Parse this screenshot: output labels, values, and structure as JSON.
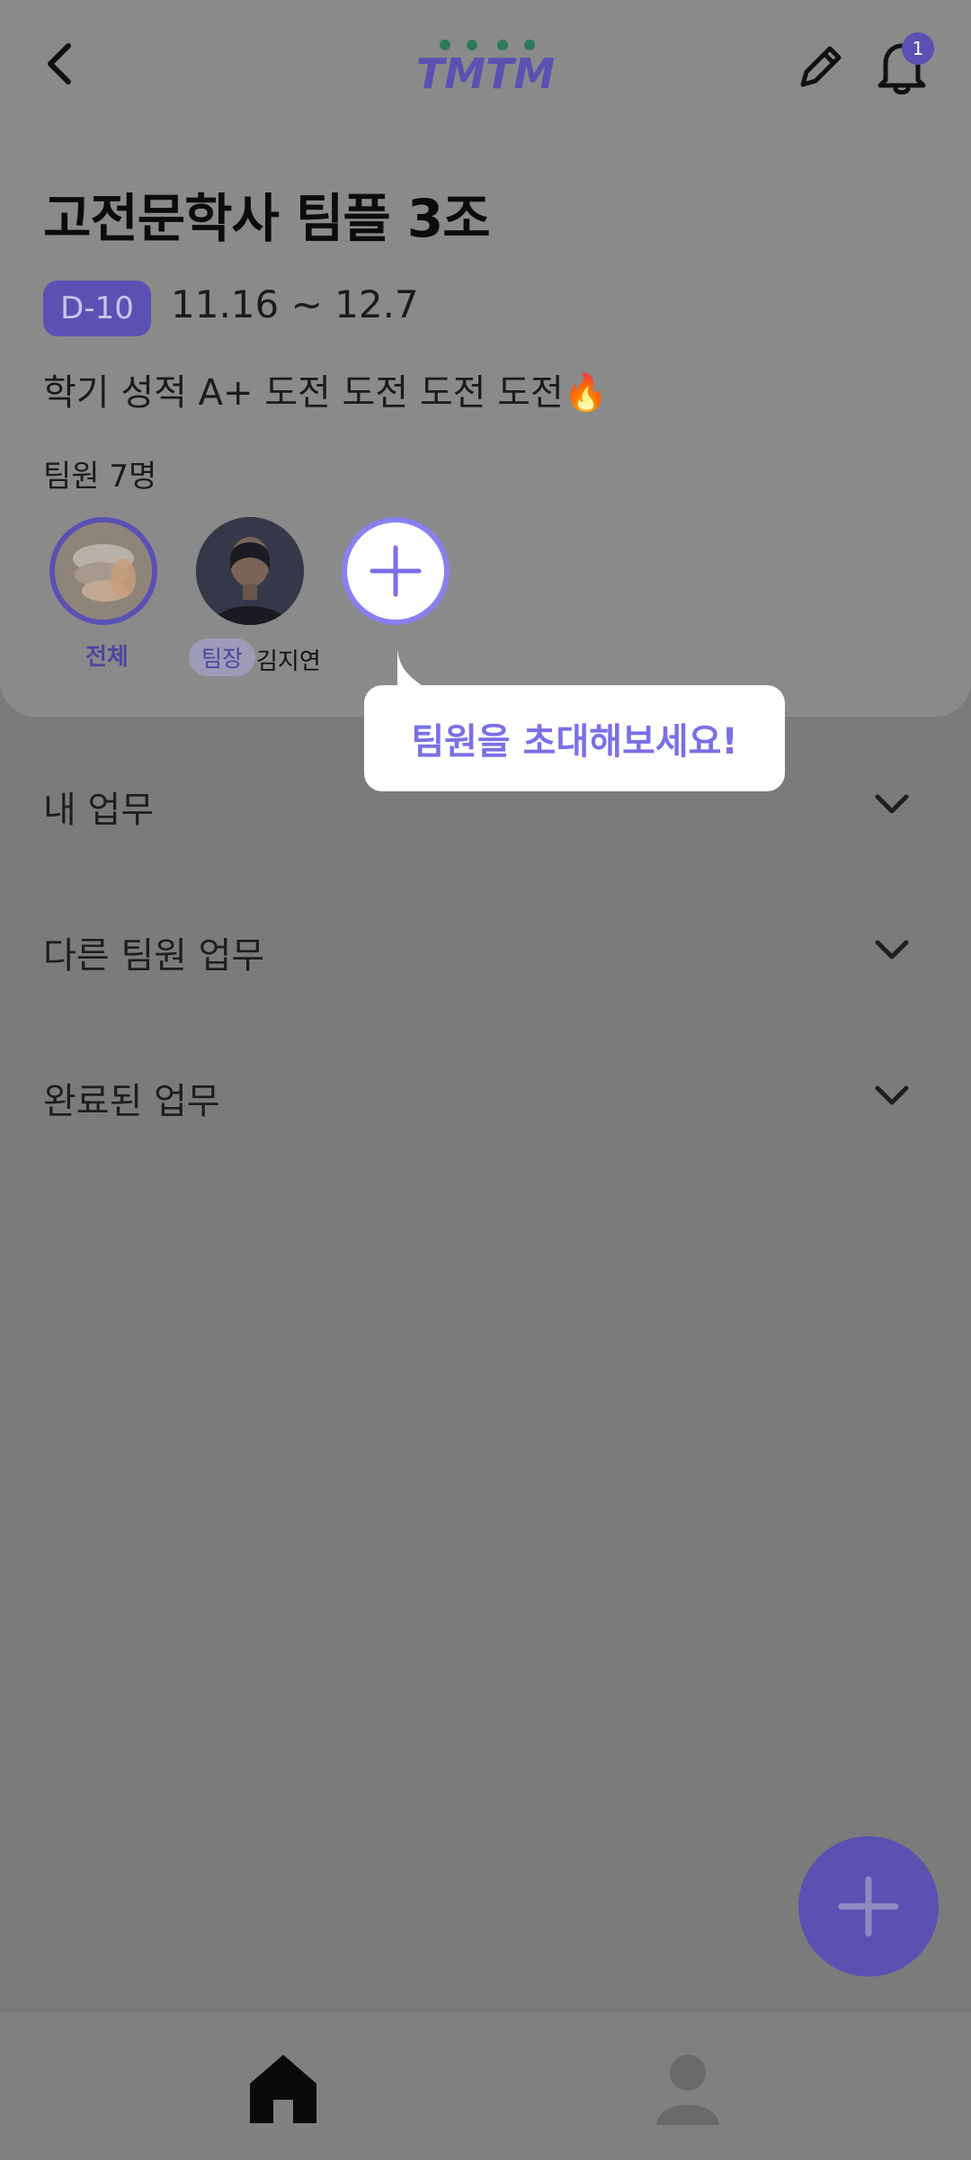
{
  "header": {
    "back_icon": "chevron-left-icon",
    "logo_text": "TMTM",
    "edit_icon": "pencil-icon",
    "bell_icon": "bell-icon",
    "notification_count": "1"
  },
  "project": {
    "title": "고전문학사 팀플 3조",
    "dday": "D-10",
    "period": "11.16 ~ 12.7",
    "description": "학기 성적 A+ 도전 도전 도전 도전🔥"
  },
  "members": {
    "label": "팀원 7명",
    "all_label": "전체",
    "leader_tag": "팀장",
    "leader_name": "김지연",
    "add_icon": "plus-icon"
  },
  "tooltip": {
    "text": "팀원을 초대해보세요!"
  },
  "sections": [
    {
      "label": "내 업무",
      "icon": "chevron-down-icon"
    },
    {
      "label": "다른 팀원 업무",
      "icon": "chevron-down-icon"
    },
    {
      "label": "완료된 업무",
      "icon": "chevron-down-icon"
    }
  ],
  "fab": {
    "icon": "plus-icon"
  },
  "bottom_nav": {
    "home_icon": "home-icon",
    "profile_icon": "person-icon"
  },
  "colors": {
    "accent": "#5a51b3",
    "accent_light": "#7b6fe6",
    "overlay": "#7b7b7b"
  }
}
